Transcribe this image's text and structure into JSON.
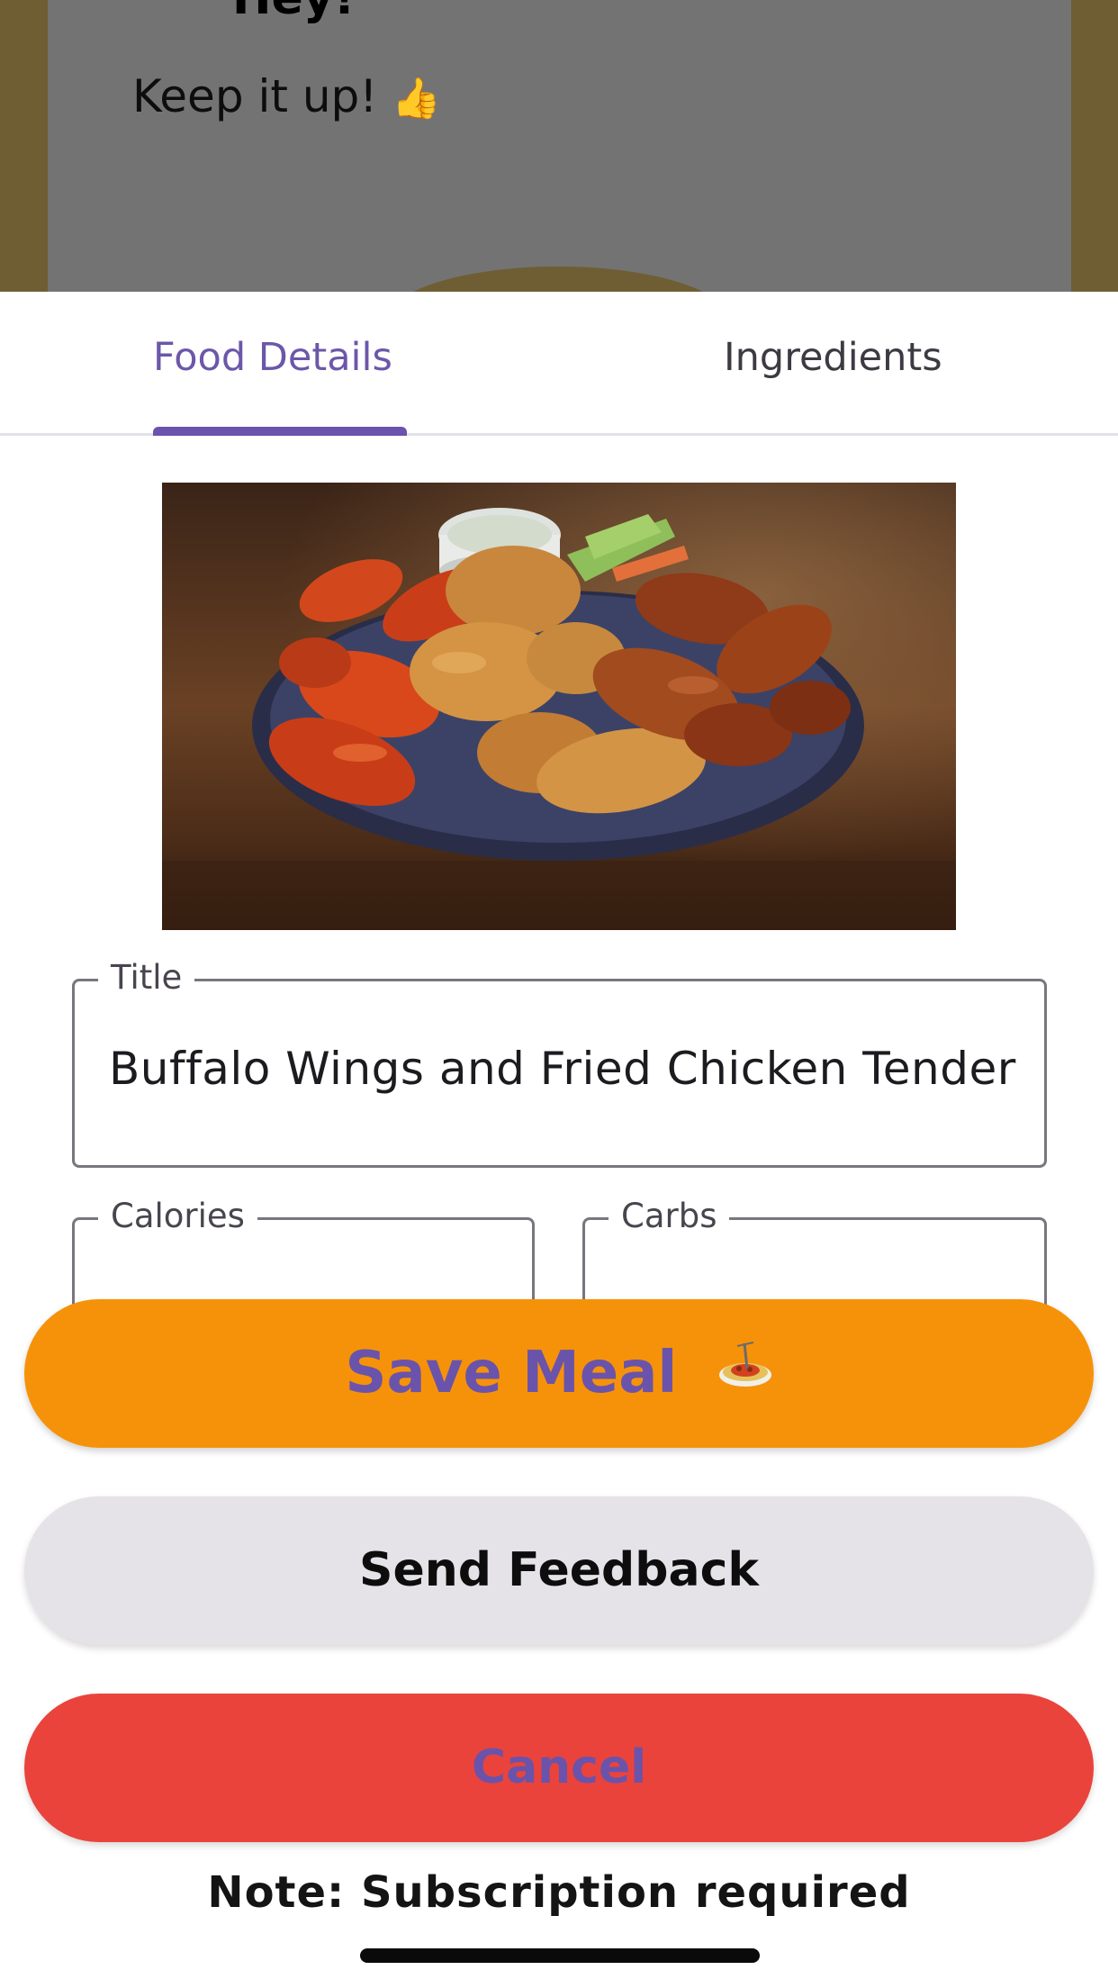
{
  "background_screen": {
    "greeting": "Hey!",
    "message": "Keep it up!",
    "message_emoji": "👍"
  },
  "tabs": [
    {
      "label": "Food Details",
      "selected": true
    },
    {
      "label": "Ingredients",
      "selected": false
    }
  ],
  "food_image": {
    "icon": "food-photo-wings-and-tenders"
  },
  "form": {
    "title": {
      "label": "Title",
      "value": "Buffalo Wings and Fried Chicken Tenders"
    },
    "calories": {
      "label": "Calories",
      "value": ""
    },
    "carbs": {
      "label": "Carbs",
      "value": ""
    }
  },
  "actions": {
    "save_label": "Save Meal",
    "save_icon": "spaghetti-emoji",
    "feedback_label": "Send Feedback",
    "cancel_label": "Cancel"
  },
  "note": "Note: Subscription required",
  "colors": {
    "accent_purple": "#6b52ae",
    "save_orange": "#f6920a",
    "feedback_gray": "#e5e3e8",
    "cancel_red": "#ea433c"
  }
}
